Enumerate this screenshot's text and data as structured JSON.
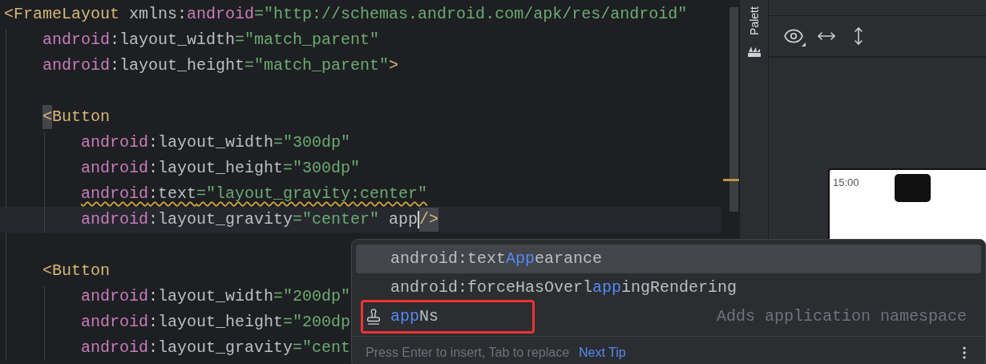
{
  "editor": {
    "lines": [
      {
        "kind": "code",
        "tokens": [
          {
            "kind": "bracket",
            "text": "<"
          },
          {
            "kind": "tag",
            "text": "FrameLayout"
          },
          {
            "kind": "plain",
            "text": " xmlns:"
          },
          {
            "kind": "namespace",
            "text": "android"
          },
          {
            "kind": "value",
            "text": "=\"http://schemas.android.com/apk/res/android\""
          }
        ],
        "children": [
          {
            "kind": "code",
            "tokens": [
              {
                "kind": "namespace",
                "text": "android"
              },
              {
                "kind": "attr",
                "text": ":layout_width"
              },
              {
                "kind": "value",
                "text": "=\"match_parent\""
              }
            ]
          },
          {
            "kind": "code",
            "tokens": [
              {
                "kind": "namespace",
                "text": "android"
              },
              {
                "kind": "attr",
                "text": ":layout_height"
              },
              {
                "kind": "value",
                "text": "=\"match_parent\""
              },
              {
                "kind": "bracket",
                "text": ">"
              }
            ]
          },
          {
            "kind": "blank"
          },
          {
            "kind": "code",
            "tokens": [
              {
                "kind": "bracket",
                "text": "<",
                "matched": true
              },
              {
                "kind": "tag",
                "text": "Button"
              }
            ],
            "children": [
              {
                "kind": "code",
                "tokens": [
                  {
                    "kind": "namespace",
                    "text": "android"
                  },
                  {
                    "kind": "attr",
                    "text": ":layout_width"
                  },
                  {
                    "kind": "value",
                    "text": "=\"300dp\""
                  }
                ]
              },
              {
                "kind": "code",
                "tokens": [
                  {
                    "kind": "namespace",
                    "text": "android"
                  },
                  {
                    "kind": "attr",
                    "text": ":layout_height"
                  },
                  {
                    "kind": "value",
                    "text": "=\"300dp\""
                  }
                ]
              },
              {
                "kind": "code",
                "warning": true,
                "tokens": [
                  {
                    "kind": "namespace",
                    "text": "android"
                  },
                  {
                    "kind": "attr",
                    "text": ":text"
                  },
                  {
                    "kind": "value",
                    "text": "=\"layout_gravity:center\""
                  }
                ]
              },
              {
                "kind": "code",
                "current": true,
                "tokens": [
                  {
                    "kind": "namespace",
                    "text": "android"
                  },
                  {
                    "kind": "attr",
                    "text": ":layout_gravity"
                  },
                  {
                    "kind": "value",
                    "text": "=\"center\""
                  },
                  {
                    "kind": "plain",
                    "text": " app"
                  },
                  {
                    "kind": "caret"
                  },
                  {
                    "kind": "bracket",
                    "text": "/>",
                    "matched": true
                  }
                ]
              }
            ]
          },
          {
            "kind": "blank"
          },
          {
            "kind": "code",
            "tokens": [
              {
                "kind": "bracket",
                "text": "<"
              },
              {
                "kind": "tag",
                "text": "Button"
              }
            ],
            "children": [
              {
                "kind": "code",
                "tokens": [
                  {
                    "kind": "namespace",
                    "text": "android"
                  },
                  {
                    "kind": "attr",
                    "text": ":layout_width"
                  },
                  {
                    "kind": "value",
                    "text": "=\"200dp\""
                  }
                ]
              },
              {
                "kind": "code",
                "tokens": [
                  {
                    "kind": "namespace",
                    "text": "android"
                  },
                  {
                    "kind": "attr",
                    "text": ":layout_height"
                  },
                  {
                    "kind": "value",
                    "text": "=\"200dp"
                  }
                ]
              },
              {
                "kind": "code",
                "tokens": [
                  {
                    "kind": "namespace",
                    "text": "android"
                  },
                  {
                    "kind": "attr",
                    "text": ":layout_gravity"
                  },
                  {
                    "kind": "value",
                    "text": "=\"cent"
                  }
                ]
              }
            ]
          }
        ]
      }
    ]
  },
  "side_tab": {
    "label": "Palett"
  },
  "preview": {
    "device": {
      "clock": "15:00"
    }
  },
  "completion": {
    "items": [
      {
        "kind": "attribute",
        "selected": true,
        "annotated": false,
        "segments": [
          {
            "text": "android:text",
            "match": false
          },
          {
            "text": "App",
            "match": true
          },
          {
            "text": "earance",
            "match": false
          }
        ]
      },
      {
        "kind": "attribute",
        "selected": false,
        "annotated": false,
        "segments": [
          {
            "text": "android:forceHasOverl",
            "match": false
          },
          {
            "text": "app",
            "match": true
          },
          {
            "text": "ingRendering",
            "match": false
          }
        ]
      },
      {
        "kind": "template",
        "selected": false,
        "annotated": true,
        "segments": [
          {
            "text": "app",
            "match": true
          },
          {
            "text": "Ns",
            "match": false
          }
        ],
        "hint": "Adds application namespace"
      }
    ],
    "footer": {
      "text": "Press Enter to insert, Tab to replace",
      "link": "Next Tip"
    }
  }
}
